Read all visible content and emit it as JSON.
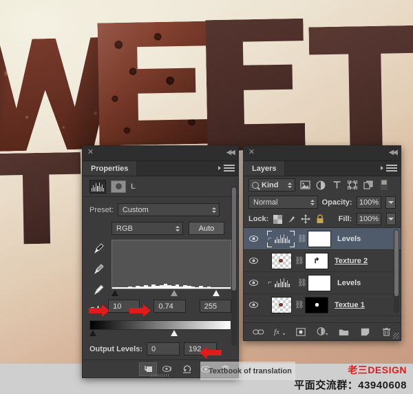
{
  "artwork": {
    "letters": [
      "W",
      "E",
      "E",
      "T"
    ],
    "background_colors": [
      "#f2eee0",
      "#e2cdb5",
      "#c79b81"
    ],
    "chocolate_color": "#7b3b2a",
    "dark_letter_color": "#4e302a"
  },
  "properties_panel": {
    "close_icon": "✕",
    "collapse_icon": "◀◀",
    "tab_label": "Properties",
    "menu_icon": "panel-menu-icon",
    "header": {
      "histogram_icon": "histogram-icon",
      "mask_icon": "mask-icon",
      "label": "L"
    },
    "preset": {
      "label": "Preset:",
      "value": "Custom"
    },
    "channel": {
      "value": "RGB",
      "auto_label": "Auto"
    },
    "eyedroppers": [
      "black-point-eyedropper",
      "gray-point-eyedropper",
      "white-point-eyedropper"
    ],
    "input_levels": {
      "black": "10",
      "gamma": "0.74",
      "white": "255"
    },
    "output_levels": {
      "label": "Output Levels:",
      "black": "0",
      "white": "192"
    },
    "footer_icons": [
      "clip-to-layer-icon",
      "preview-toggle-icon",
      "reset-icon",
      "visibility-eye-icon",
      "delete-icon"
    ]
  },
  "layers_panel": {
    "close_icon": "✕",
    "collapse_icon": "◀◀",
    "tab_label": "Layers",
    "menu_icon": "panel-menu-icon",
    "filter": {
      "kind_label": "Kind",
      "icons": [
        "pixel-filter-icon",
        "adjustment-filter-icon",
        "type-filter-icon",
        "shape-filter-icon",
        "smart-object-filter-icon",
        "filter-toggle-switch"
      ]
    },
    "blend": {
      "mode": "Normal",
      "opacity_label": "Opacity:",
      "opacity_value": "100%"
    },
    "lock": {
      "label": "Lock:",
      "icons": [
        "lock-transparency-icon",
        "lock-pixels-icon",
        "lock-position-icon",
        "lock-all-icon"
      ],
      "fill_label": "Fill:",
      "fill_value": "100%"
    },
    "layers": [
      {
        "name": "Levels",
        "type": "adjustment",
        "selected": true,
        "clipped": true,
        "mask": "white",
        "underlined": false
      },
      {
        "name": "Texture 2",
        "type": "pixel",
        "selected": false,
        "clipped": false,
        "mask": "white",
        "underlined": true
      },
      {
        "name": "Levels",
        "type": "adjustment",
        "selected": false,
        "clipped": true,
        "mask": "white",
        "underlined": false
      },
      {
        "name": "Textue 1",
        "type": "pixel",
        "selected": false,
        "clipped": false,
        "mask": "black",
        "underlined": true
      }
    ],
    "footer_icons": [
      "link-layers-icon",
      "layer-style-fx-icon",
      "add-mask-icon",
      "adjustment-layer-icon",
      "new-group-icon",
      "new-layer-icon",
      "delete-layer-icon"
    ],
    "selected_color": "#4f5b6b"
  },
  "annotations": {
    "arrow_color": "#e01b1b",
    "arrows": [
      "input-black-level-arrow",
      "input-gamma-arrow",
      "output-white-level-arrow"
    ],
    "overlay_text": "Textbook of translation"
  },
  "watermark": {
    "brand": "老三DESIGN",
    "qq_group": "平面交流群：43940608",
    "brand_color": "#e21b1b"
  }
}
